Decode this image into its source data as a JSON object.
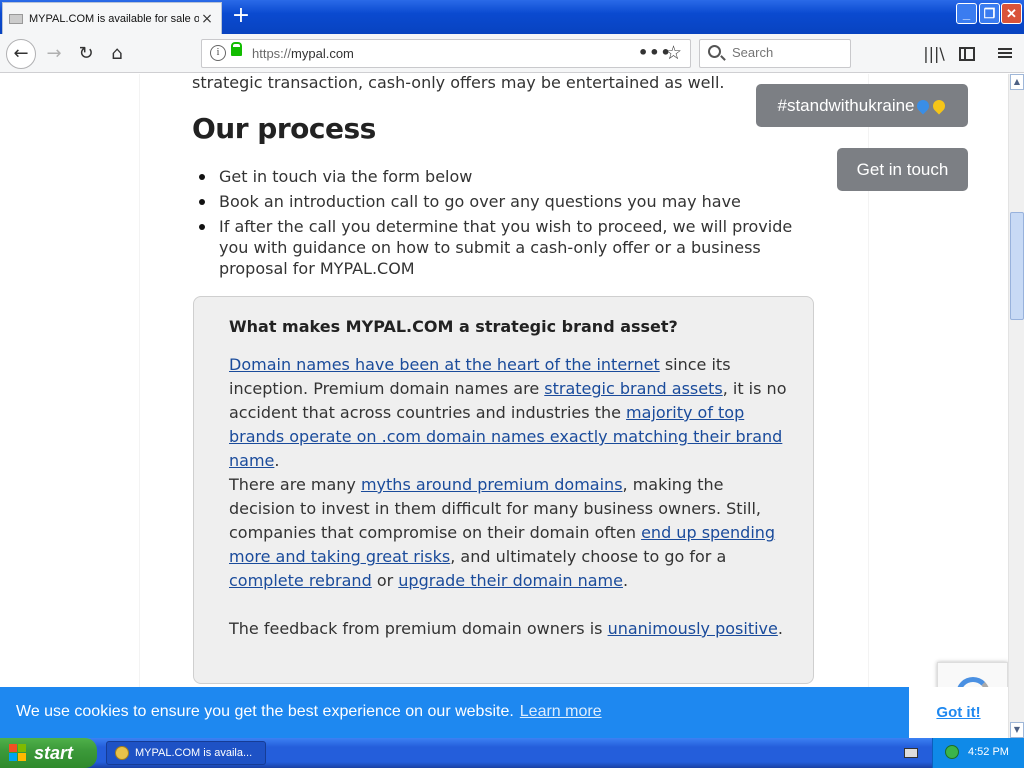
{
  "browser": {
    "tab_title": "MYPAL.COM is available for sale or",
    "tab_close": "×",
    "new_tab": "+",
    "window_minimize": "_",
    "window_maximize": "❐",
    "window_close": "✕",
    "url_protocol": "https://",
    "url_domain": "mypal.com",
    "url_more": "•••",
    "bookmark_star": "☆",
    "search_placeholder": "Search",
    "back": "←",
    "forward": "→",
    "reload": "↻",
    "home": "⌂",
    "library": "|||\\",
    "info": "i"
  },
  "page": {
    "intro_tail": "strategic transaction, cash-only offers may be entertained as well.",
    "process_heading": "Our process",
    "process_steps": [
      "Get in touch via the form below",
      "Book an introduction call to go over any questions you may have",
      "If after the call you determine that you wish to proceed, we will provide you with guidance on how to submit a cash-only offer or a business proposal for MYPAL.COM"
    ],
    "card": {
      "title": "What makes MYPAL.COM a strategic brand asset?",
      "p1": {
        "link1": "Domain names have been at the heart of the internet",
        "text1": " since its inception. Premium domain names are ",
        "link2": "strategic brand assets",
        "text2": ", it is no accident that across countries and industries the ",
        "link3": "majority of top brands operate on .com domain names exactly matching their brand name",
        "text3": "."
      },
      "p2": {
        "text1": "There are many ",
        "link1": "myths around premium domains",
        "text2": ", making the decision to invest in them difficult for many business owners. Still, companies that compromise on their domain often ",
        "link2": "end up spending more and taking great risks",
        "text3": ", and ultimately choose to go for a ",
        "link3": "complete rebrand",
        "text4": " or ",
        "link4": "upgrade their domain name",
        "text5": "."
      },
      "p3": {
        "text1": "The feedback from premium domain owners is ",
        "link1": "unanimously positive",
        "text2": "."
      }
    },
    "ukraine_button": "#standwithukraine",
    "get_in_touch_button": "Get in touch",
    "colors": {
      "link": "#1a4b9b",
      "cookie_bar": "#1e88f0",
      "float_button": "#7c7f84",
      "heart_blue": "#3a8ee6",
      "heart_yellow": "#f5c518"
    }
  },
  "cookie_bar": {
    "message": "We use cookies to ensure you get the best experience on our website.",
    "learn_more": "Learn more",
    "accept": "Got it!"
  },
  "taskbar": {
    "start_label": "start",
    "task_label": "MYPAL.COM is availa...",
    "clock": "4:52 PM"
  }
}
